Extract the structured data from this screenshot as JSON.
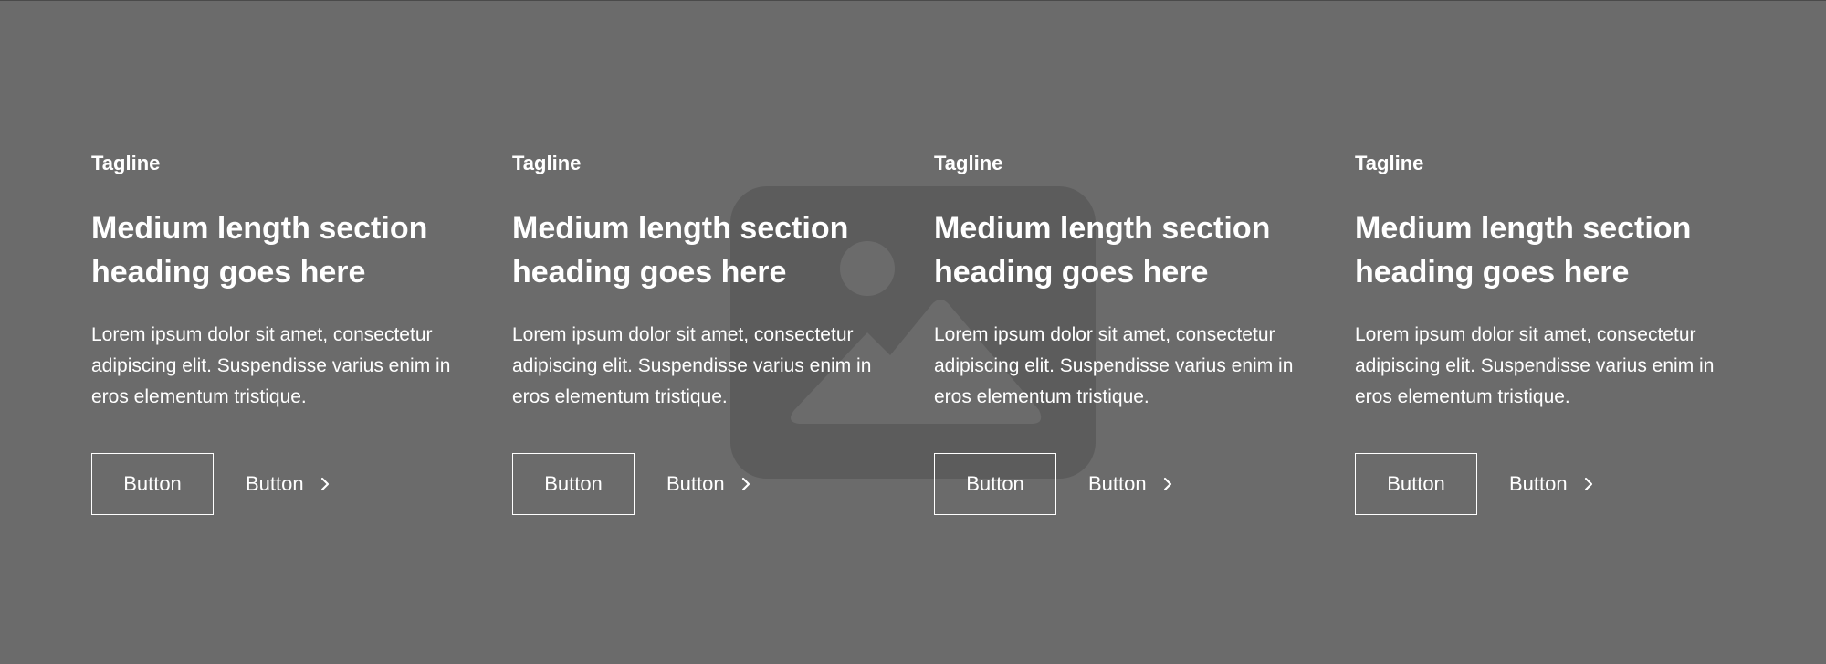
{
  "colors": {
    "background": "#6b6b6b",
    "placeholder_image": "#5c5c5c",
    "placeholder_shape": "#6b6b6b",
    "text": "#ffffff"
  },
  "background": {
    "image_icon": "image-placeholder-icon"
  },
  "cards": [
    {
      "tagline": "Tagline",
      "heading_line1": "Medium length section",
      "heading_line2": "heading goes here",
      "body_line1": "Lorem ipsum dolor sit amet, consectetur",
      "body_line2": "adipiscing elit. Suspendisse varius enim in",
      "body_line3": "eros elementum tristique.",
      "primary_button": "Button",
      "secondary_button": "Button",
      "secondary_icon": "chevron-right-icon"
    },
    {
      "tagline": "Tagline",
      "heading_line1": "Medium length section",
      "heading_line2": "heading goes here",
      "body_line1": "Lorem ipsum dolor sit amet, consectetur",
      "body_line2": "adipiscing elit. Suspendisse varius enim in",
      "body_line3": "eros elementum tristique.",
      "primary_button": "Button",
      "secondary_button": "Button",
      "secondary_icon": "chevron-right-icon"
    },
    {
      "tagline": "Tagline",
      "heading_line1": "Medium length section",
      "heading_line2": "heading goes here",
      "body_line1": "Lorem ipsum dolor sit amet, consectetur",
      "body_line2": "adipiscing elit. Suspendisse varius enim in",
      "body_line3": "eros elementum tristique.",
      "primary_button": "Button",
      "secondary_button": "Button",
      "secondary_icon": "chevron-right-icon"
    },
    {
      "tagline": "Tagline",
      "heading_line1": "Medium length section",
      "heading_line2": "heading goes here",
      "body_line1": "Lorem ipsum dolor sit amet, consectetur",
      "body_line2": "adipiscing elit. Suspendisse varius enim in",
      "body_line3": "eros elementum tristique.",
      "primary_button": "Button",
      "secondary_button": "Button",
      "secondary_icon": "chevron-right-icon"
    }
  ]
}
